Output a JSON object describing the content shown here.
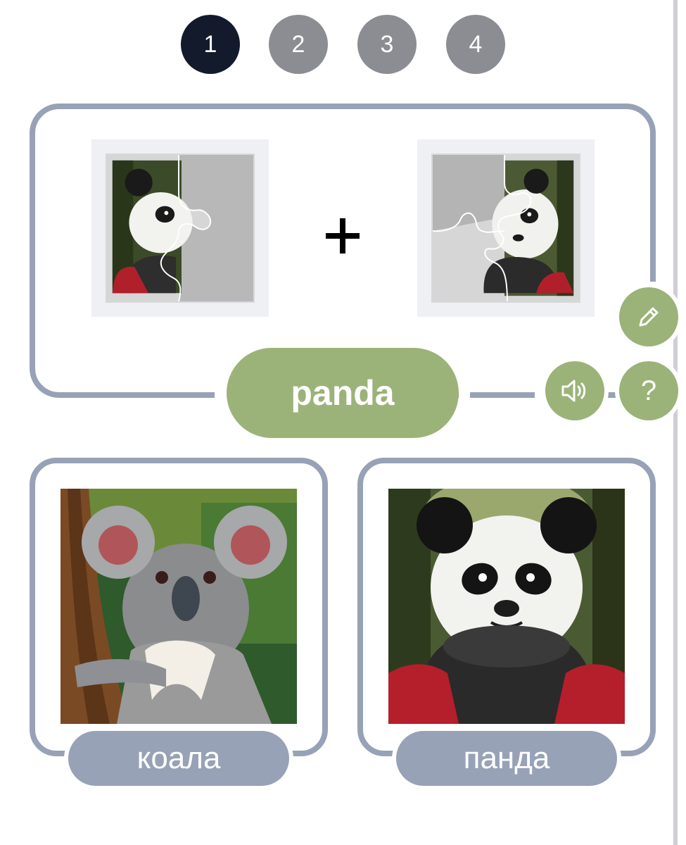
{
  "steps": [
    "1",
    "2",
    "3",
    "4"
  ],
  "active_step": "1",
  "main_word": "panda",
  "operator": "+",
  "buttons": {
    "edit_icon": "pencil-icon",
    "sound_icon": "speaker-icon",
    "help_label": "?"
  },
  "answers": [
    {
      "label": "коала",
      "image": "koala"
    },
    {
      "label": "панда",
      "image": "panda"
    }
  ],
  "colors": {
    "active_step": "#131a2b",
    "inactive_step": "#8b8d92",
    "accent_green": "#9bb378",
    "card_border": "#97a2b6",
    "label_bg": "#97a2b6"
  }
}
